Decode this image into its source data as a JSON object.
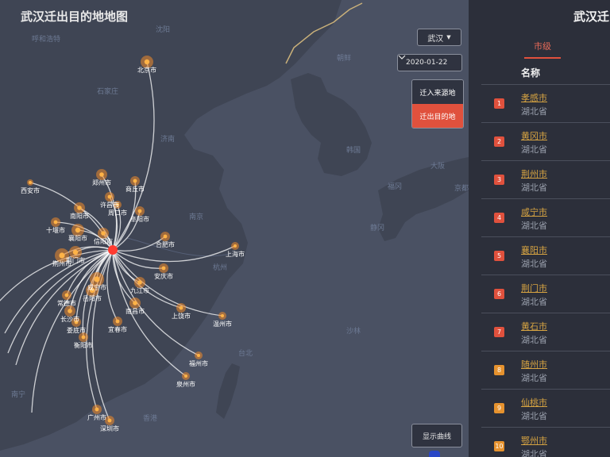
{
  "map": {
    "title": "武汉迁出目的地地图",
    "origin": "武汉",
    "cities": [
      {
        "name": "北京市"
      },
      {
        "name": "西安市"
      },
      {
        "name": "郑州市"
      },
      {
        "name": "商丘市"
      },
      {
        "name": "许昌市"
      },
      {
        "name": "周口市"
      },
      {
        "name": "南阳市"
      },
      {
        "name": "阜阳市"
      },
      {
        "name": "十堰市"
      },
      {
        "name": "襄阳市"
      },
      {
        "name": "信阳市"
      },
      {
        "name": "合肥市"
      },
      {
        "name": "上海市"
      },
      {
        "name": "荆门市"
      },
      {
        "name": "荆州市"
      },
      {
        "name": "安庆市"
      },
      {
        "name": "咸宁市"
      },
      {
        "name": "九江市"
      },
      {
        "name": "常德市"
      },
      {
        "name": "岳阳市"
      },
      {
        "name": "南昌市"
      },
      {
        "name": "上饶市"
      },
      {
        "name": "长沙市"
      },
      {
        "name": "娄底市"
      },
      {
        "name": "宜春市"
      },
      {
        "name": "温州市"
      },
      {
        "name": "衡阳市"
      },
      {
        "name": "福州市"
      },
      {
        "name": "泉州市"
      },
      {
        "name": "广州市"
      },
      {
        "name": "深圳市"
      }
    ],
    "geo_labels": [
      "朝鲜",
      "韩国",
      "沈阳",
      "呼和浩特",
      "石家庄",
      "济南",
      "南京",
      "杭州",
      "台北",
      "香港",
      "南宁",
      "福冈",
      "大阪",
      "京都",
      "静冈",
      "沙林"
    ]
  },
  "controls": {
    "city_select": "武汉",
    "date_select": "2020-01-22",
    "toggle_in": "迁入来源地",
    "toggle_out": "迁出目的地",
    "curve_button": "显示曲线"
  },
  "panel": {
    "title": "武汉迁出",
    "tab": "市级",
    "column_header": "名称",
    "rows": [
      {
        "rank": "1",
        "city": "孝感市",
        "province": "湖北省"
      },
      {
        "rank": "2",
        "city": "黄冈市",
        "province": "湖北省"
      },
      {
        "rank": "3",
        "city": "荆州市",
        "province": "湖北省"
      },
      {
        "rank": "4",
        "city": "咸宁市",
        "province": "湖北省"
      },
      {
        "rank": "5",
        "city": "襄阳市",
        "province": "湖北省"
      },
      {
        "rank": "6",
        "city": "荆门市",
        "province": "湖北省"
      },
      {
        "rank": "7",
        "city": "黄石市",
        "province": "湖北省"
      },
      {
        "rank": "8",
        "city": "随州市",
        "province": "湖北省"
      },
      {
        "rank": "9",
        "city": "仙桃市",
        "province": "湖北省"
      },
      {
        "rank": "10",
        "city": "鄂州市",
        "province": "湖北省"
      }
    ]
  },
  "colors": {
    "accent": "#e0513d",
    "link": "#d7a442",
    "map_bg": "#3a3f4e",
    "land": "#424858",
    "sea": "#4a5163",
    "flow": "#ffffff",
    "dot": "#f08a2a"
  }
}
